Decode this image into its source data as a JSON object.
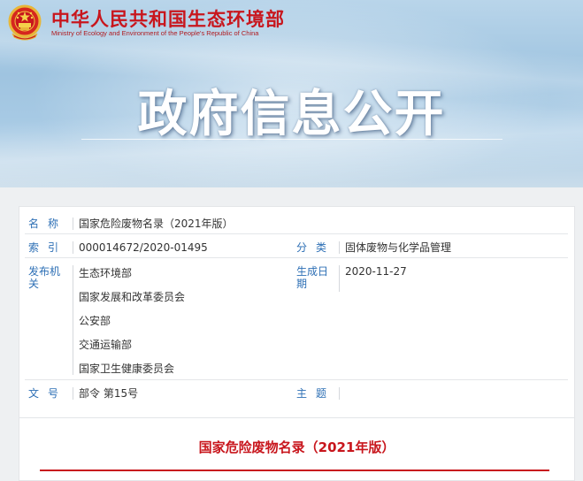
{
  "header": {
    "ministry_cn": "中华人民共和国生态环境部",
    "ministry_en": "Ministry of Ecology and Environment of the People's Republic of China",
    "banner_title": "政府信息公开",
    "emblem_icon": "national-emblem-icon"
  },
  "colors": {
    "brand_red": "#c8161d",
    "label_blue": "#2d6fb5",
    "banner_sky": "#a9cbe5"
  },
  "meta": {
    "name_label": "名称",
    "name_value": "国家危险废物名录（2021年版）",
    "index_label": "索引",
    "index_value": "000014672/2020-01495",
    "category_label": "分类",
    "category_value": "固体废物与化学品管理",
    "issuer_label": "发布机关",
    "issuers": [
      "生态环境部",
      "国家发展和改革委员会",
      "公安部",
      "交通运输部",
      "国家卫生健康委员会"
    ],
    "date_label": "生成日期",
    "date_value": "2020-11-27",
    "docno_label": "文号",
    "docno_value": "部令 第15号",
    "subject_label": "主题",
    "subject_value": ""
  },
  "document": {
    "title": "国家危险废物名录（2021年版）"
  }
}
